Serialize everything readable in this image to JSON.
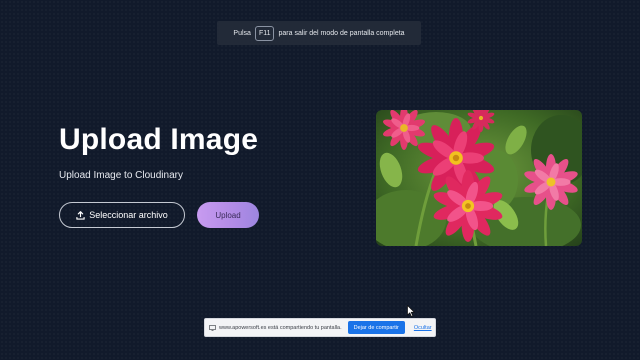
{
  "fullscreen_hint": {
    "prefix": "Pulsa",
    "key": "F11",
    "suffix": "para salir del modo de pantalla completa"
  },
  "main": {
    "title": "Upload Image",
    "subtitle": "Upload Image to Cloudinary",
    "select_button_label": "Seleccionar archivo",
    "select_button_icon": "upload-icon",
    "upload_button_label": "Upload",
    "preview_image": "flower-photo"
  },
  "share_bar": {
    "message": "www.apowersoft.es está compartiendo tu pantalla.",
    "stop_label": "Dejar de compartir",
    "hide_label": "Ocultar"
  },
  "colors": {
    "background": "#111a2b",
    "upload_gradient_start": "#c89bf0",
    "upload_gradient_end": "#9d86e0",
    "share_button": "#1a73e8"
  }
}
